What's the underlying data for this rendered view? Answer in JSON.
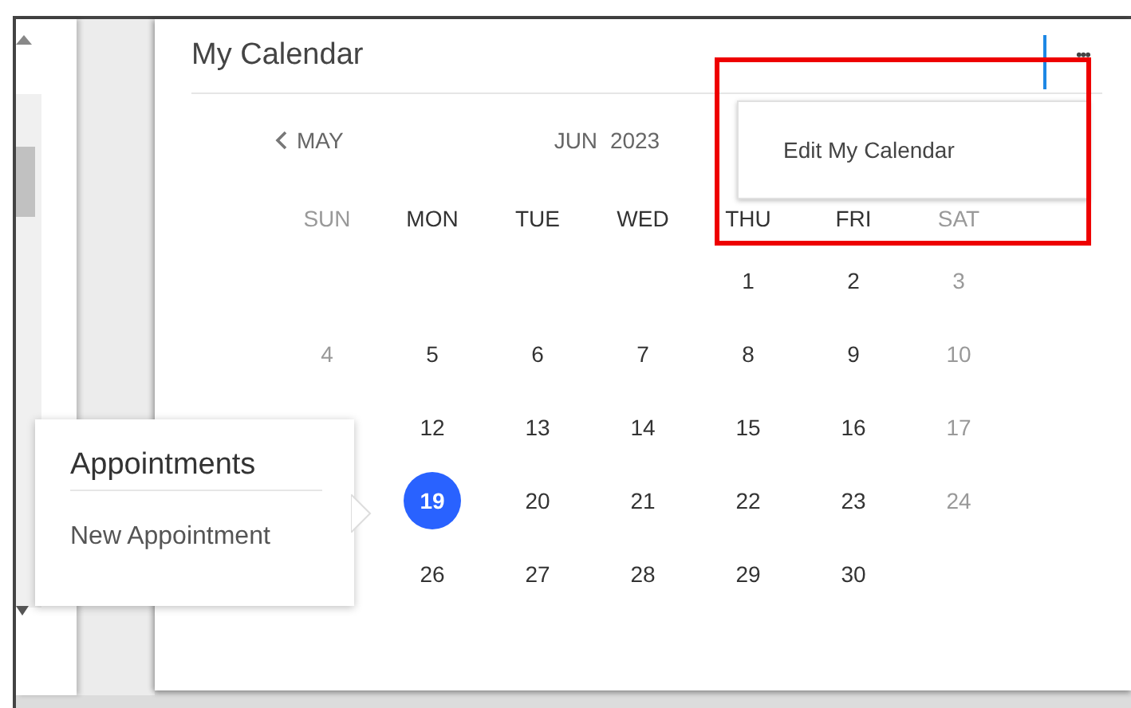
{
  "calendar": {
    "title": "My Calendar",
    "more_button": "•••",
    "prev_month": "MAY",
    "month": "JUN",
    "year": "2023",
    "weekdays": [
      {
        "label": "SUN",
        "weekend": true
      },
      {
        "label": "MON",
        "weekend": false
      },
      {
        "label": "TUE",
        "weekend": false
      },
      {
        "label": "WED",
        "weekend": false
      },
      {
        "label": "THU",
        "weekend": false
      },
      {
        "label": "FRI",
        "weekend": false
      },
      {
        "label": "SAT",
        "weekend": true
      }
    ],
    "weeks": [
      [
        {
          "kind": "empty"
        },
        {
          "kind": "empty"
        },
        {
          "kind": "empty"
        },
        {
          "kind": "empty"
        },
        {
          "kind": "day",
          "day": "1",
          "weekend": false,
          "selected": false
        },
        {
          "kind": "day",
          "day": "2",
          "weekend": false,
          "selected": false
        },
        {
          "kind": "day",
          "day": "3",
          "weekend": true,
          "selected": false
        }
      ],
      [
        {
          "kind": "day",
          "day": "4",
          "weekend": true,
          "selected": false
        },
        {
          "kind": "day",
          "day": "5",
          "weekend": false,
          "selected": false
        },
        {
          "kind": "day",
          "day": "6",
          "weekend": false,
          "selected": false
        },
        {
          "kind": "day",
          "day": "7",
          "weekend": false,
          "selected": false
        },
        {
          "kind": "day",
          "day": "8",
          "weekend": false,
          "selected": false
        },
        {
          "kind": "day",
          "day": "9",
          "weekend": false,
          "selected": false
        },
        {
          "kind": "day",
          "day": "10",
          "weekend": true,
          "selected": false
        }
      ],
      [
        {
          "kind": "empty"
        },
        {
          "kind": "day",
          "day": "12",
          "weekend": false,
          "selected": false
        },
        {
          "kind": "day",
          "day": "13",
          "weekend": false,
          "selected": false
        },
        {
          "kind": "day",
          "day": "14",
          "weekend": false,
          "selected": false
        },
        {
          "kind": "day",
          "day": "15",
          "weekend": false,
          "selected": false
        },
        {
          "kind": "day",
          "day": "16",
          "weekend": false,
          "selected": false
        },
        {
          "kind": "day",
          "day": "17",
          "weekend": true,
          "selected": false
        }
      ],
      [
        {
          "kind": "empty"
        },
        {
          "kind": "day",
          "day": "19",
          "weekend": false,
          "selected": true
        },
        {
          "kind": "day",
          "day": "20",
          "weekend": false,
          "selected": false
        },
        {
          "kind": "day",
          "day": "21",
          "weekend": false,
          "selected": false
        },
        {
          "kind": "day",
          "day": "22",
          "weekend": false,
          "selected": false
        },
        {
          "kind": "day",
          "day": "23",
          "weekend": false,
          "selected": false
        },
        {
          "kind": "day",
          "day": "24",
          "weekend": true,
          "selected": false
        }
      ],
      [
        {
          "kind": "empty"
        },
        {
          "kind": "day",
          "day": "26",
          "weekend": false,
          "selected": false
        },
        {
          "kind": "day",
          "day": "27",
          "weekend": false,
          "selected": false
        },
        {
          "kind": "day",
          "day": "28",
          "weekend": false,
          "selected": false
        },
        {
          "kind": "day",
          "day": "29",
          "weekend": false,
          "selected": false
        },
        {
          "kind": "day",
          "day": "30",
          "weekend": false,
          "selected": false
        },
        {
          "kind": "empty"
        }
      ]
    ]
  },
  "more_menu": {
    "items": [
      "Edit My Calendar"
    ]
  },
  "appointments_popover": {
    "title": "Appointments",
    "items": [
      "New Appointment"
    ]
  }
}
